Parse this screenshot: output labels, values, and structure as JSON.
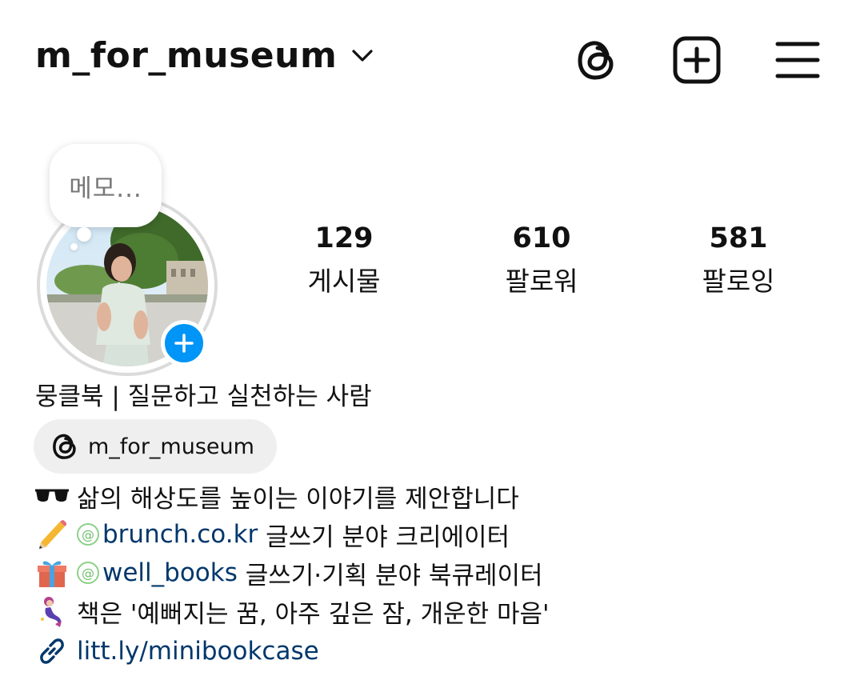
{
  "header": {
    "username": "m_for_museum",
    "icons": [
      "chevron-down-icon",
      "threads-icon",
      "create-post-icon",
      "menu-icon"
    ]
  },
  "note": {
    "text": "메모..."
  },
  "stats": [
    {
      "count": "129",
      "label": "게시물"
    },
    {
      "count": "610",
      "label": "팔로워"
    },
    {
      "count": "581",
      "label": "팔로잉"
    }
  ],
  "bio": {
    "name": "뭉클북 | 질문하고 실천하는 사람",
    "threads_handle": "m_for_museum",
    "line1": "삶의 해상도를 높이는 이야기를 제안합니다",
    "line2_mention": "brunch.co.kr",
    "line2_rest": " 글쓰기 분야 크리에이터",
    "line3_mention": "well_books",
    "line3_rest": " 글쓰기·기획 분야 북큐레이터",
    "line4": "책은 '예뻐지는 꿈, 아주 깊은 잠, 개운한 마음'",
    "link": "litt.ly/minibookcase"
  },
  "colors": {
    "accent": "#0095f6",
    "link": "#00376b",
    "mention_icon": "#6bbf68",
    "chip_bg": "#efefef"
  }
}
